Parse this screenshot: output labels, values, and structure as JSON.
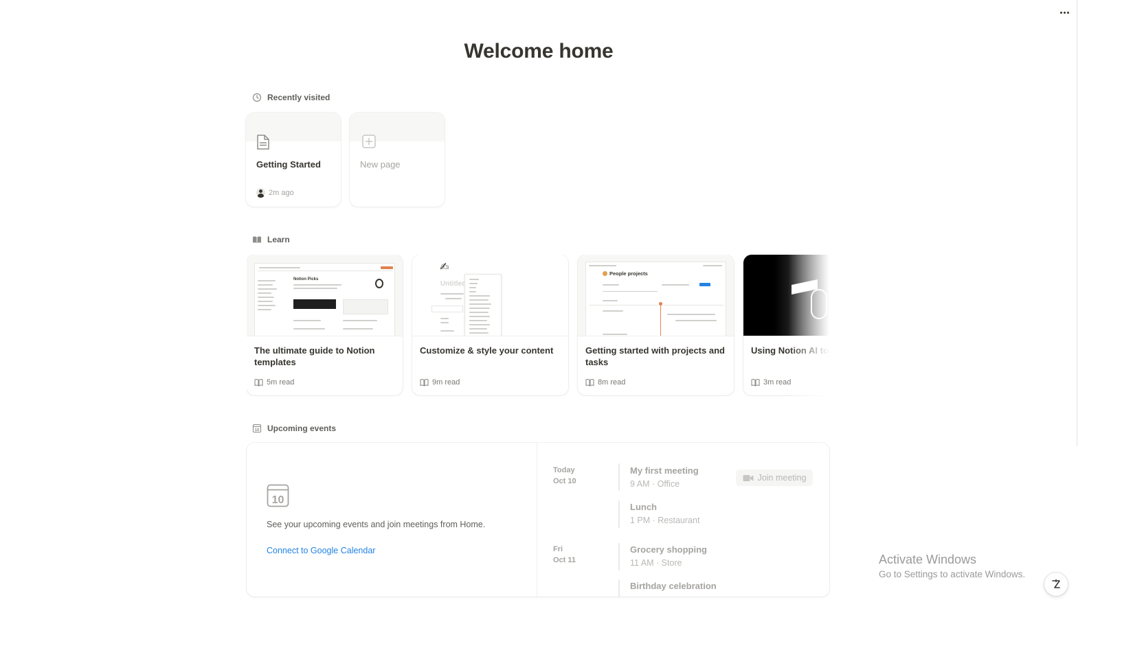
{
  "page": {
    "title": "Welcome home"
  },
  "recently_visited": {
    "header": "Recently visited",
    "items": [
      {
        "title": "Getting Started",
        "meta": "2m ago",
        "icon": "page-icon"
      },
      {
        "title": "New page",
        "icon": "plus-square-icon"
      }
    ]
  },
  "learn": {
    "header": "Learn",
    "items": [
      {
        "title": "The ultimate guide to Notion templates",
        "meta": "5m read"
      },
      {
        "title": "Customize & style your content",
        "meta": "9m read"
      },
      {
        "title": "Getting started with projects and tasks",
        "meta": "8m read"
      },
      {
        "title": "Using Notion AI to your impact",
        "meta": "3m read"
      }
    ],
    "thumb_text": {
      "picks": "Notion Picks",
      "untitled": "Untitled",
      "people_projects": "People projects"
    }
  },
  "events": {
    "header": "Upcoming events",
    "description": "See your upcoming events and join meetings from Home.",
    "connect_link": "Connect to Google Calendar",
    "calendar_day": "10",
    "join_label": "Join meeting",
    "days": [
      {
        "weekday": "Today",
        "date": "Oct 10",
        "items": [
          {
            "title": "My first meeting",
            "sub": "9 AM · Office"
          },
          {
            "title": "Lunch",
            "sub": "1 PM · Restaurant"
          }
        ]
      },
      {
        "weekday": "Fri",
        "date": "Oct 11",
        "items": [
          {
            "title": "Grocery shopping",
            "sub": "11 AM · Store"
          },
          {
            "title": "Birthday celebration",
            "sub": ""
          }
        ]
      }
    ]
  },
  "watermark": {
    "line1": "Activate Windows",
    "line2": "Go to Settings to activate Windows."
  },
  "colors": {
    "link": "#2383e2",
    "text": "#37352f",
    "muted": "#a5a4a0"
  }
}
